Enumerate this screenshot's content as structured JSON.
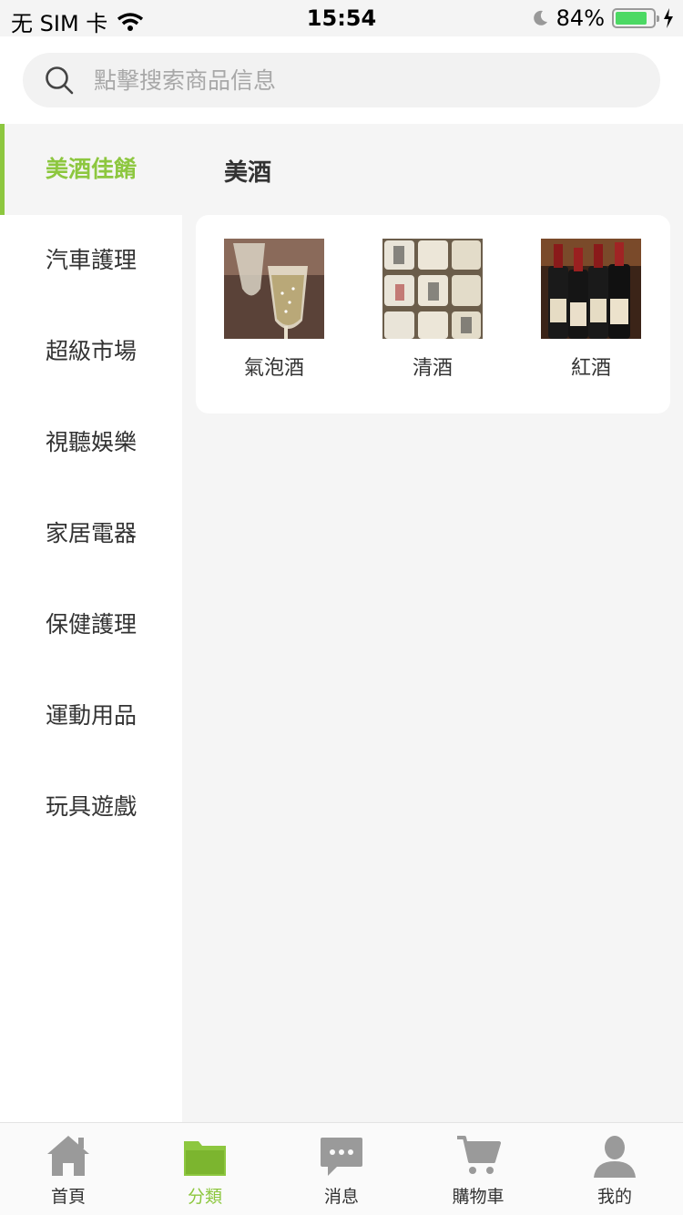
{
  "status_bar": {
    "carrier": "无 SIM 卡",
    "time": "15:54",
    "battery": "84%"
  },
  "search": {
    "placeholder": "點擊搜索商品信息"
  },
  "sidebar": {
    "items": [
      {
        "label": "美酒佳餚",
        "active": true
      },
      {
        "label": "汽車護理"
      },
      {
        "label": "超級市場"
      },
      {
        "label": "視聽娛樂"
      },
      {
        "label": "家居電器"
      },
      {
        "label": "保健護理"
      },
      {
        "label": "運動用品"
      },
      {
        "label": "玩具遊戲"
      }
    ]
  },
  "main": {
    "heading": "美酒",
    "products": [
      {
        "name": "氣泡酒"
      },
      {
        "name": "清酒"
      },
      {
        "name": "紅酒"
      }
    ]
  },
  "tabbar": {
    "tabs": [
      {
        "label": "首頁",
        "icon": "home-icon"
      },
      {
        "label": "分類",
        "icon": "folder-icon",
        "active": true
      },
      {
        "label": "消息",
        "icon": "message-icon"
      },
      {
        "label": "購物車",
        "icon": "cart-icon"
      },
      {
        "label": "我的",
        "icon": "user-icon"
      }
    ]
  },
  "colors": {
    "accent": "#8dc73f",
    "background": "#f5f5f5"
  }
}
